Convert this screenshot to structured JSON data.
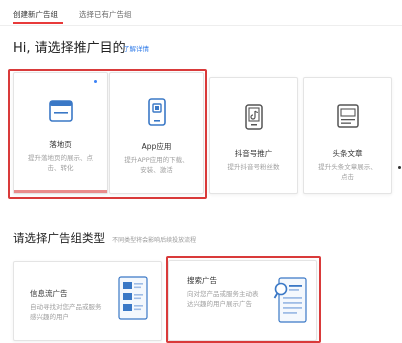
{
  "tabs": [
    {
      "label": "创建新广告组",
      "active": true
    },
    {
      "label": "选择已有广告组",
      "active": false
    }
  ],
  "heading": "Hi, 请选择推广目的",
  "learn_more": "了解详情",
  "purposes": [
    {
      "title": "落地页",
      "desc": "提升落地页的展示、点击、转化",
      "icon": "browser-window-icon",
      "has_dot": true,
      "progress": 1.0
    },
    {
      "title": "App应用",
      "desc": "提升APP应用的下载、安装、激活",
      "icon": "smartphone-app-icon",
      "has_dot": false,
      "progress": 0
    },
    {
      "title": "抖音号推广",
      "desc": "提升抖音号粉丝数",
      "icon": "douyin-phone-icon",
      "has_dot": false,
      "progress": 0
    },
    {
      "title": "头条文章",
      "desc": "提升头条文章展示、点击",
      "icon": "article-icon",
      "has_dot": false,
      "progress": 0
    }
  ],
  "section2": {
    "title": "请选择广告组类型",
    "subtitle": "不同类型将会影响后续投放流程"
  },
  "types": [
    {
      "title": "信息流广告",
      "desc": "自动寻找对您产品或服务感兴趣的用户",
      "icon": "feed-list-icon"
    },
    {
      "title": "搜索广告",
      "desc": "向对您产品或服务主动表达兴趣的用户展示广告",
      "icon": "search-results-icon"
    }
  ],
  "colors": {
    "accent_red": "#d93a3a",
    "link_blue": "#2f7be9",
    "icon_blue": "#3a78c6",
    "progress_pink": "#e98b8b"
  }
}
